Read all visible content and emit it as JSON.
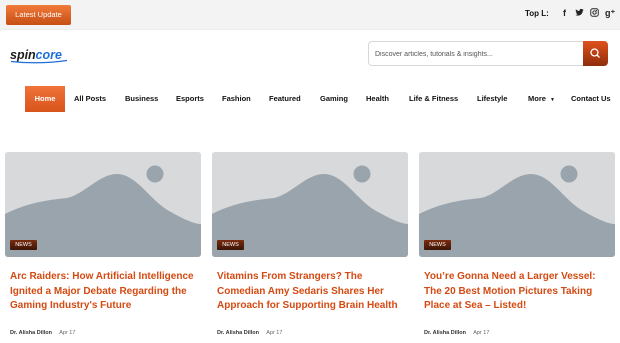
{
  "topbar": {
    "latest_label": "Latest Update",
    "top_label": "Top L:",
    "socials": [
      "facebook-icon",
      "twitter-icon",
      "instagram-icon",
      "google-plus-icon"
    ]
  },
  "header": {
    "logo_text": "spincore",
    "search_placeholder": "Discover articles, tutorials & insights..."
  },
  "nav": {
    "items": [
      "Home",
      "All Posts",
      "Business",
      "Esports",
      "Fashion",
      "Featured",
      "Gaming",
      "Health",
      "Life & Fitness",
      "Lifestyle",
      "More",
      "Contact Us"
    ]
  },
  "cards": [
    {
      "badge": "NEWS",
      "title": "Arc Raiders: How Artificial Intelligence Ignited a Major Debate Regarding the Gaming Industry's Future",
      "author": "Dr. Alisha Dillon",
      "date": "Apr 17"
    },
    {
      "badge": "NEWS",
      "title": "Vitamins From Strangers? The Comedian Amy Sedaris Shares Her Approach for Supporting Brain Health",
      "author": "Dr. Alisha Dillon",
      "date": "Apr 17"
    },
    {
      "badge": "NEWS",
      "title": "You’re Gonna Need a Larger Vessel: The 20 Best Motion Pictures Taking Place at Sea – Listed!",
      "author": "Dr. Alisha Dillon",
      "date": "Apr 17"
    }
  ],
  "colors": {
    "accent": "#e0521d",
    "title": "#d44a12",
    "placeholder": "#d7d9db",
    "mountain": "#9aa4ac"
  }
}
